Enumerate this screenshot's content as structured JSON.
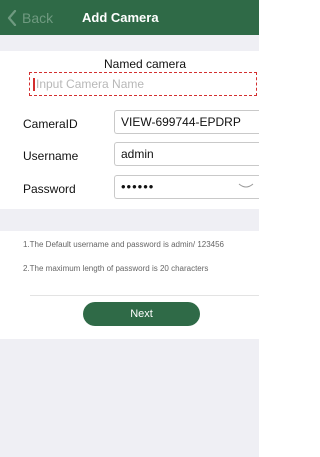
{
  "navbar": {
    "back_label": "Back",
    "title": "Add Camera",
    "background_color": "#2f6a47"
  },
  "form": {
    "named_camera_label": "Named camera",
    "name_placeholder": "Input Camera Name",
    "name_value": "",
    "camera_id_label": "CameraID",
    "camera_id_value": "VIEW-699744-EPDRP",
    "username_label": "Username",
    "username_value": "admin",
    "password_label": "Password",
    "password_display": "••••••"
  },
  "notes": {
    "line1": "1.The Default username and password is admin/ 123456",
    "line2": "2.The maximum length of password is 20 characters"
  },
  "next_button_label": "Next",
  "icons": {
    "back": "chevron-left-icon",
    "password_toggle": "eye-closed-icon"
  }
}
